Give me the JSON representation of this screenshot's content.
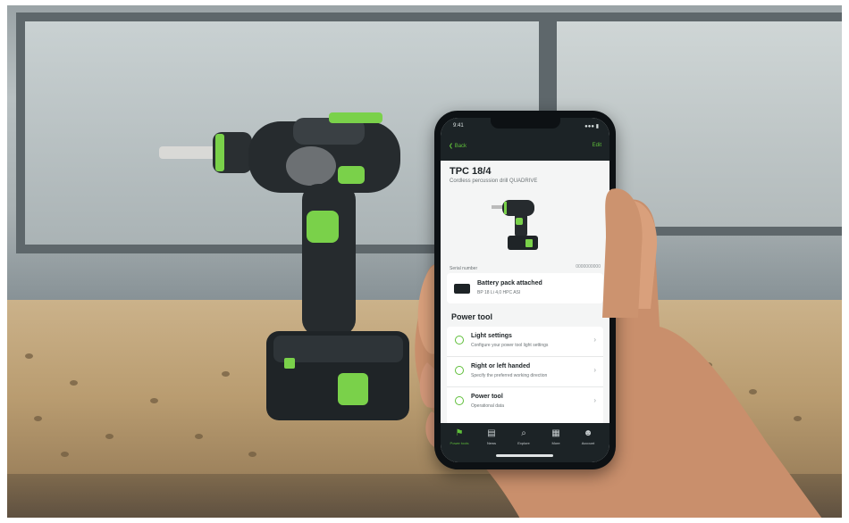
{
  "colors": {
    "accent": "#5fbf3a",
    "dark": "#1c2326"
  },
  "phone": {
    "status": {
      "time": "9:41",
      "signal": "●●● ▮"
    },
    "nav": {
      "back": "❮ Back",
      "action": "Edit"
    },
    "tool": {
      "title": "TPC 18/4",
      "subtitle": "Cordless percussion drill QUADRIVE",
      "serial_label": "Serial number",
      "serial_value": "0000000000"
    },
    "battery": {
      "title": "Battery pack attached",
      "subtitle": "BP 18 Li 4,0 HPC ASI"
    },
    "section_title": "Power tool",
    "rows": [
      {
        "icon": "bulb-icon",
        "title": "Light settings",
        "subtitle": "Configure your power tool light settings"
      },
      {
        "icon": "hand-icon",
        "title": "Right or left handed",
        "subtitle": "Specify the preferred working direction"
      },
      {
        "icon": "power-icon",
        "title": "Power tool",
        "subtitle": "Operational data"
      }
    ],
    "tabs": [
      {
        "icon": "tool-icon",
        "glyph": "⚑",
        "label": "Power tools"
      },
      {
        "icon": "chat-icon",
        "glyph": "▤",
        "label": "News"
      },
      {
        "icon": "search-icon",
        "glyph": "⌕",
        "label": "Explore"
      },
      {
        "icon": "grid-icon",
        "glyph": "▦",
        "label": "More"
      },
      {
        "icon": "account-icon",
        "glyph": "☻",
        "label": "Account"
      }
    ]
  }
}
